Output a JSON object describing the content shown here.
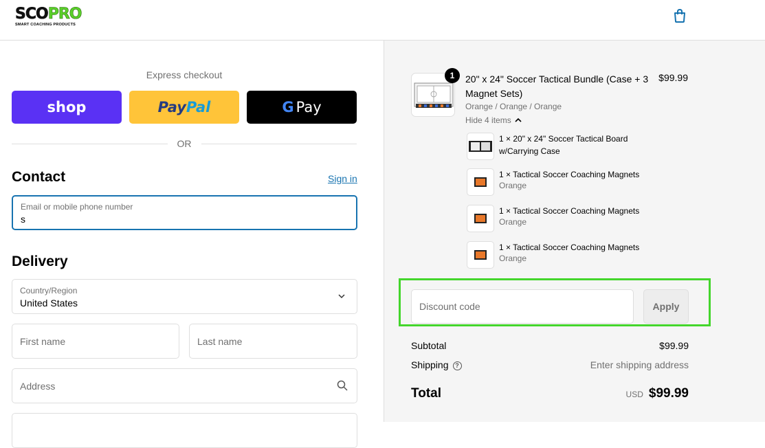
{
  "brand": {
    "logo_main_left": "SCO",
    "logo_main_right": "PRO",
    "logo_sub": "SMART COACHING PRODUCTS",
    "accent": "#5bd12a",
    "link_color": "#1773b0"
  },
  "header": {
    "cart_icon": "shopping-bag-icon"
  },
  "express": {
    "title": "Express checkout",
    "shop_label": "shop",
    "paypal_label_1": "Pay",
    "paypal_label_2": "Pal",
    "gpay_g": "G",
    "gpay_label": "Pay",
    "or_label": "OR"
  },
  "contact": {
    "title": "Contact",
    "signin_label": "Sign in",
    "email_label": "Email or mobile phone number",
    "email_value": "s"
  },
  "delivery": {
    "title": "Delivery",
    "country_label": "Country/Region",
    "country_value": "United States",
    "first_name_placeholder": "First name",
    "last_name_placeholder": "Last name",
    "address_placeholder": "Address"
  },
  "order": {
    "product": {
      "quantity": "1",
      "title": "20\" x 24\" Soccer Tactical Bundle (Case + 3 Magnet Sets)",
      "variant": "Orange / Orange / Orange",
      "price": "$99.99",
      "hide_items_label": "Hide 4 items"
    },
    "bundle_items": [
      {
        "name": "1 × 20\" x 24\" Soccer Tactical Board w/Carrying Case",
        "variant": ""
      },
      {
        "name": "1 × Tactical Soccer Coaching Magnets",
        "variant": "Orange"
      },
      {
        "name": "1 × Tactical Soccer Coaching Magnets",
        "variant": "Orange"
      },
      {
        "name": "1 × Tactical Soccer Coaching Magnets",
        "variant": "Orange"
      }
    ],
    "discount_placeholder": "Discount code",
    "apply_label": "Apply",
    "highlight_color": "#44d62c",
    "subtotal_label": "Subtotal",
    "subtotal_value": "$99.99",
    "shipping_label": "Shipping",
    "shipping_value": "Enter shipping address",
    "total_label": "Total",
    "total_currency": "USD",
    "total_value": "$99.99"
  }
}
